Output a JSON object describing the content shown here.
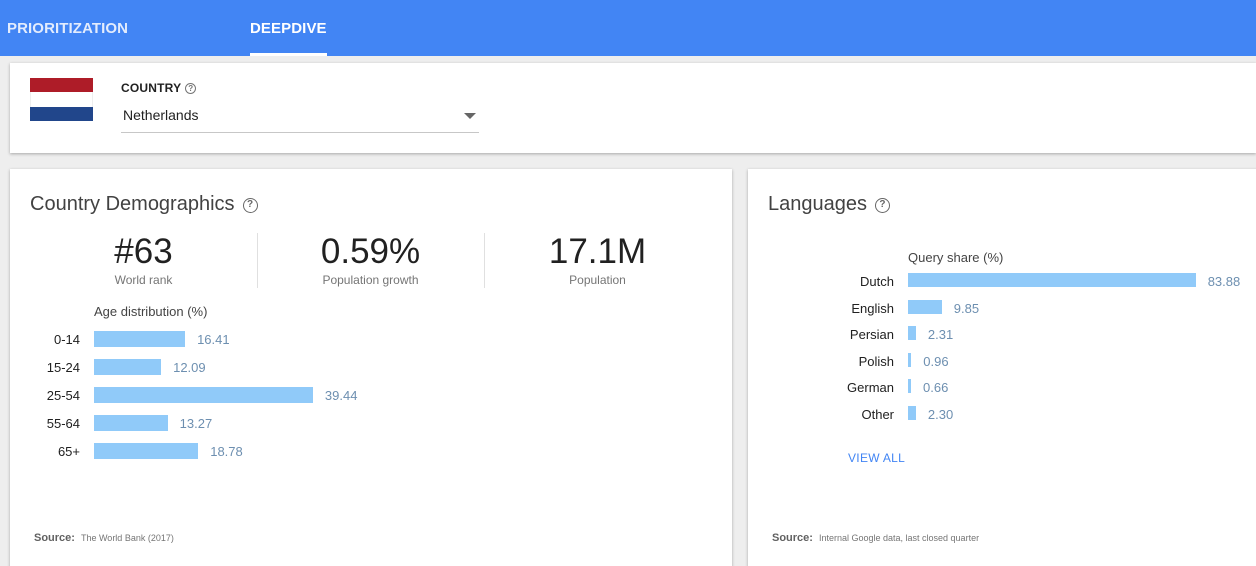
{
  "tabs": [
    {
      "label": "PRIORITIZATION",
      "active": false
    },
    {
      "label": "DEEPDIVE",
      "active": true
    }
  ],
  "country": {
    "label": "COUNTRY",
    "help_icon": "help-circle-icon",
    "selected": "Netherlands",
    "flag_colors": [
      "#ae1c28",
      "#ffffff",
      "#21468b"
    ]
  },
  "demographics": {
    "title": "Country Demographics",
    "stats": [
      {
        "value": "#63",
        "label": "World rank"
      },
      {
        "value": "0.59%",
        "label": "Population growth"
      },
      {
        "value": "17.1M",
        "label": "Population"
      }
    ],
    "chart_title": "Age distribution (%)",
    "rows": [
      {
        "label": "0-14",
        "value": 16.41,
        "text": "16.41"
      },
      {
        "label": "15-24",
        "value": 12.09,
        "text": "12.09"
      },
      {
        "label": "25-54",
        "value": 39.44,
        "text": "39.44"
      },
      {
        "label": "55-64",
        "value": 13.27,
        "text": "13.27"
      },
      {
        "label": "65+",
        "value": 18.78,
        "text": "18.78"
      }
    ],
    "source_label": "Source:",
    "source_text": "The World Bank (2017)"
  },
  "languages": {
    "title": "Languages",
    "chart_title": "Query share (%)",
    "rows": [
      {
        "label": "Dutch",
        "value": 83.88,
        "text": "83.88"
      },
      {
        "label": "English",
        "value": 9.85,
        "text": "9.85"
      },
      {
        "label": "Persian",
        "value": 2.31,
        "text": "2.31"
      },
      {
        "label": "Polish",
        "value": 0.96,
        "text": "0.96"
      },
      {
        "label": "German",
        "value": 0.66,
        "text": "0.66"
      },
      {
        "label": "Other",
        "value": 2.3,
        "text": "2.30"
      }
    ],
    "view_all": "VIEW ALL",
    "source_label": "Source:",
    "source_text": "Internal Google data, last closed quarter"
  },
  "colors": {
    "header": "#4285f4",
    "bar": "#90caf9",
    "bar_value": "#6d8fb0",
    "link": "#4285f4"
  }
}
